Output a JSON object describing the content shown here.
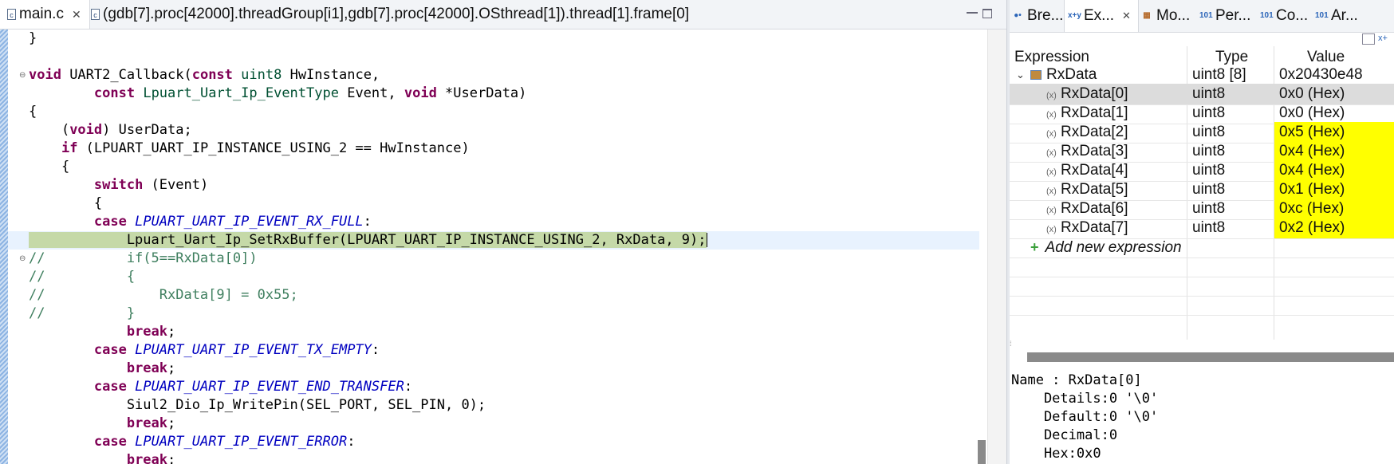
{
  "editor": {
    "tabs": [
      {
        "label": "main.c",
        "icon": "c-file-icon"
      },
      {
        "label": "(gdb[7].proc[42000].threadGroup[i1],gdb[7].proc[42000].OSthread[1]).thread[1].frame[0]",
        "icon": "c-file-icon"
      }
    ],
    "code_lines": [
      "}",
      "",
      "void UART2_Callback(const uint8 HwInstance,",
      "        const Lpuart_Uart_Ip_EventType Event, void *UserData)",
      "{",
      "    (void) UserData;",
      "    if (LPUART_UART_IP_INSTANCE_USING_2 == HwInstance)",
      "    {",
      "        switch (Event)",
      "        {",
      "        case LPUART_UART_IP_EVENT_RX_FULL:",
      "            Lpuart_Uart_Ip_SetRxBuffer(LPUART_UART_IP_INSTANCE_USING_2, RxData, 9);",
      "//          if(5==RxData[0])",
      "//          {",
      "//              RxData[9] = 0x55;",
      "//          }",
      "            break;",
      "        case LPUART_UART_IP_EVENT_TX_EMPTY:",
      "            break;",
      "        case LPUART_UART_IP_EVENT_END_TRANSFER:",
      "            Siul2_Dio_Ip_WritePin(SEL_PORT, SEL_PIN, 0);",
      "            break;",
      "        case LPUART_UART_IP_EVENT_ERROR:",
      "            break;"
    ]
  },
  "right_panel": {
    "tabs": [
      {
        "label": "Bre...",
        "icon": "breakpoints-icon"
      },
      {
        "label": "Ex...",
        "icon": "expressions-icon"
      },
      {
        "label": "Mo...",
        "icon": "modules-icon"
      },
      {
        "label": "Per...",
        "icon": "peripherals-icon"
      },
      {
        "label": "Co...",
        "icon": "console-icon"
      },
      {
        "label": "Ar...",
        "icon": "array-icon"
      }
    ],
    "columns": [
      "Expression",
      "Type",
      "Value"
    ],
    "rows": [
      {
        "expr": "RxData",
        "type": "uint8 [8]",
        "value": "0x20430e48"
      },
      {
        "expr": "RxData[0]",
        "type": "uint8",
        "value": "0x0 (Hex)"
      },
      {
        "expr": "RxData[1]",
        "type": "uint8",
        "value": "0x0 (Hex)"
      },
      {
        "expr": "RxData[2]",
        "type": "uint8",
        "value": "0x5 (Hex)"
      },
      {
        "expr": "RxData[3]",
        "type": "uint8",
        "value": "0x4 (Hex)"
      },
      {
        "expr": "RxData[4]",
        "type": "uint8",
        "value": "0x4 (Hex)"
      },
      {
        "expr": "RxData[5]",
        "type": "uint8",
        "value": "0x1 (Hex)"
      },
      {
        "expr": "RxData[6]",
        "type": "uint8",
        "value": "0xc (Hex)"
      },
      {
        "expr": "RxData[7]",
        "type": "uint8",
        "value": "0x2 (Hex)"
      }
    ],
    "add_expression": "Add new expression",
    "details": [
      "Name : RxData[0]",
      "    Details:0 '\\0'",
      "    Default:0 '\\0'",
      "    Decimal:0",
      "    Hex:0x0"
    ]
  },
  "colors": {
    "changed_value_bg": "#ffff00",
    "current_line_bg": "#e8f2fe",
    "instruction_pointer_bg": "#c5d9a8",
    "keyword": "#7f0055",
    "enum_constant": "#0000c0",
    "comment": "#3f7f5f"
  }
}
